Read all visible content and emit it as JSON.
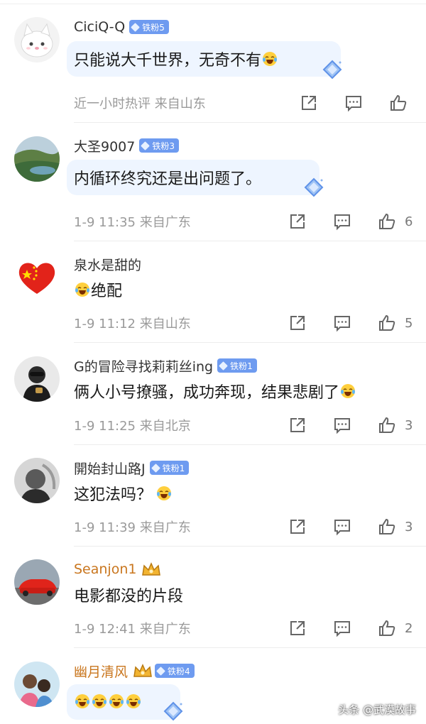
{
  "comments": [
    {
      "username": "CiciQ-Q",
      "badge": "铁粉5",
      "text": "只能说大千世界，无奇不有",
      "meta": "近一小时热评  来自山东",
      "likes": ""
    },
    {
      "username": "大圣9007",
      "badge": "铁粉3",
      "text": "内循环终究还是出问题了。",
      "meta": "1-9 11:35  来自广东",
      "likes": "6"
    },
    {
      "username": "泉水是甜的",
      "badge": "",
      "text": "绝配",
      "meta": "1-9 11:12  来自山东",
      "likes": "5"
    },
    {
      "username": "G的冒险寻找莉莉丝ing",
      "badge": "铁粉1",
      "text": "俩人小号撩骚，成功奔现，结果悲剧了",
      "meta": "1-9 11:25  来自北京",
      "likes": "3"
    },
    {
      "username": "開始封山路J",
      "badge": "铁粉1",
      "text": "这犯法吗？",
      "meta": "1-9 11:39  来自广东",
      "likes": "3"
    },
    {
      "username": "Seanjon1",
      "badge": "",
      "text": "电影都没的片段",
      "meta": "1-9 12:41  来自广东",
      "likes": "2"
    },
    {
      "username": "幽月清风",
      "badge": "铁粉4",
      "text": "",
      "meta": "",
      "likes": ""
    }
  ],
  "icons": {
    "share": "share-icon",
    "comment": "comment-icon",
    "like": "thumbs-up-icon",
    "emoji": "laugh-cry-emoji-icon"
  },
  "colors": {
    "badge": "#6e9bf0",
    "vip_name": "#c9761e",
    "meta": "#9a9a9a",
    "bubble": "#eef5ff"
  },
  "watermark": "头条 @武漠故事"
}
